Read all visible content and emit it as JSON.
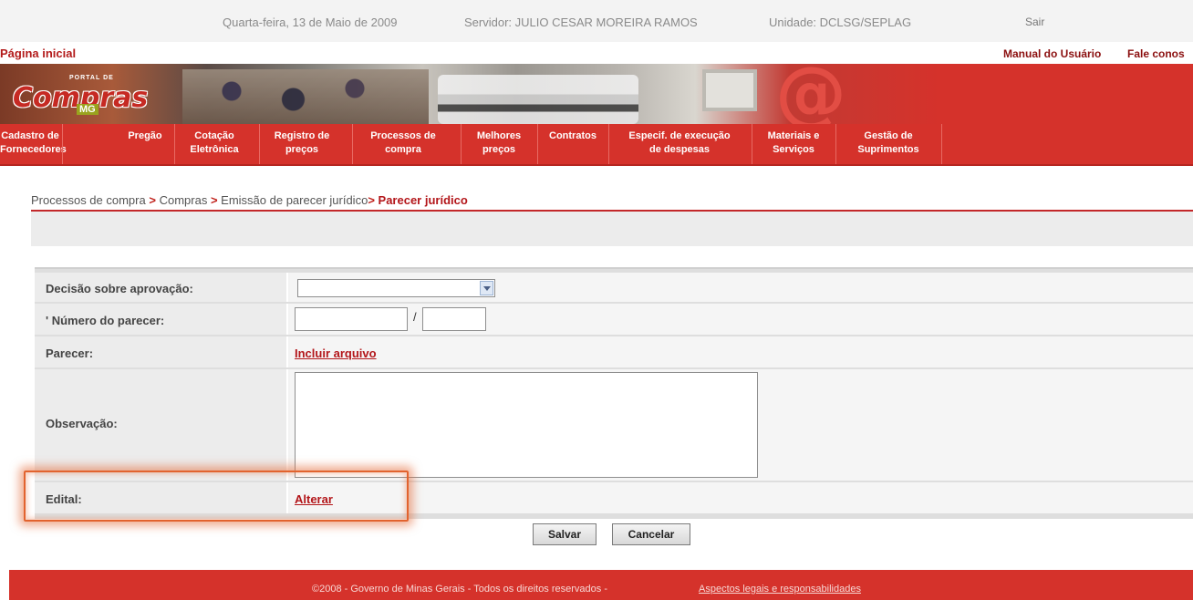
{
  "topbar": {
    "date": "Quarta-feira, 13 de Maio de 2009",
    "server": "Servidor: JULIO CESAR MOREIRA RAMOS",
    "unit": "Unidade: DCLSG/SEPLAG",
    "logout": "Sair"
  },
  "header": {
    "home": "Página inicial",
    "manual": "Manual do Usuário",
    "contact": "Fale conos"
  },
  "logo": {
    "portal": "PORTAL DE",
    "name": "Compras",
    "state": "MG"
  },
  "nav": [
    {
      "line1": "Cadastro de",
      "line2": "Fornecedores"
    },
    {
      "line1": "Pregão",
      "line2": ""
    },
    {
      "line1": "Cotação",
      "line2": "Eletrônica"
    },
    {
      "line1": "Registro de",
      "line2": "preços"
    },
    {
      "line1": "Processos de",
      "line2": "compra"
    },
    {
      "line1": "Melhores",
      "line2": "preços"
    },
    {
      "line1": "Contratos",
      "line2": ""
    },
    {
      "line1": "Especif. de execução",
      "line2": "de despesas"
    },
    {
      "line1": "Materiais e",
      "line2": "Serviços"
    },
    {
      "line1": "Gestão de",
      "line2": "Suprimentos"
    }
  ],
  "breadcrumb": {
    "level1": "Processos de compra",
    "level2": "Compras",
    "level3": "Emissão de parecer jurídico",
    "current": "Parecer jurídico",
    "separator": ">"
  },
  "form": {
    "decision_label": "Decisão sobre aprovação:",
    "decision_value": "",
    "number_label": "' Número do parecer:",
    "number_value": "",
    "year_value": "",
    "number_separator": "/",
    "opinion_label": "Parecer:",
    "opinion_link": "Incluir arquivo",
    "observation_label": "Observação:",
    "observation_value": "",
    "notice_label": "Edital:",
    "notice_link": "Alterar"
  },
  "buttons": {
    "save": "Salvar",
    "cancel": "Cancelar"
  },
  "footer": {
    "copyright": "©2008 - Governo de Minas Gerais - Todos os direitos reservados -",
    "legal_link": "Aspectos legais e responsabilidades"
  },
  "colors": {
    "brand_red": "#d5322b",
    "link_red": "#b3161a",
    "highlight": "#e2632e"
  }
}
